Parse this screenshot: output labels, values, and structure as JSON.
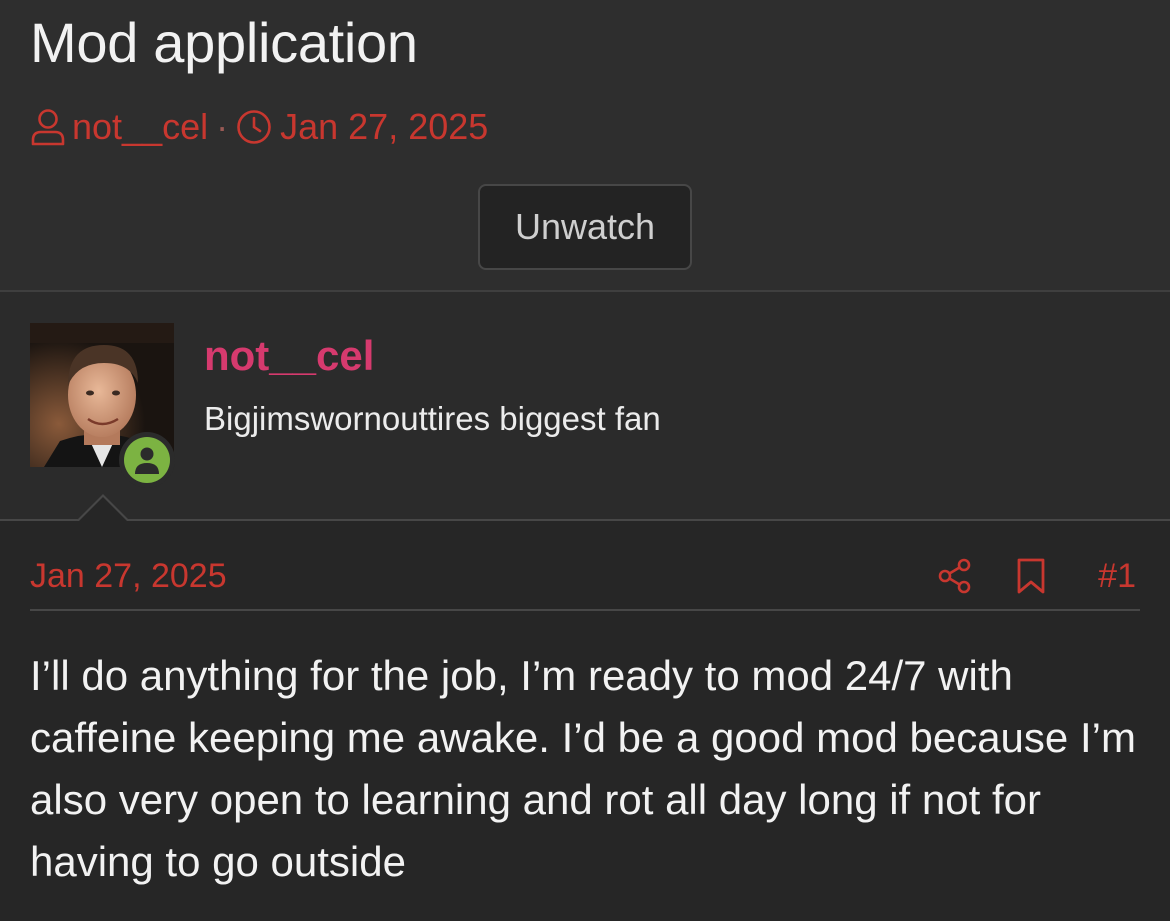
{
  "thread": {
    "title": "Mod application",
    "author": "not__cel",
    "date": "Jan 27, 2025",
    "separator": "·",
    "watch_button_label": "Unwatch"
  },
  "author_block": {
    "username": "not__cel",
    "user_title": "Bigjimswornouttires biggest fan",
    "online": true
  },
  "post": {
    "date": "Jan 27, 2025",
    "number": "#1",
    "content": "I’ll do anything for the job, I’m ready to mod 24/7 with caffeine keeping me awake. I’d be a good mod because I’m also very open to learning and rot all day long if not for having to go outside"
  },
  "icons": {
    "author": "user-icon",
    "date": "clock-icon",
    "share": "share-icon",
    "bookmark": "bookmark-icon",
    "online": "online-user-icon"
  },
  "colors": {
    "background": "#2b2b2b",
    "accent_red": "#c8372f",
    "username_pink": "#d63a6e",
    "online_green": "#7cb342",
    "text": "#f2f2f2"
  }
}
